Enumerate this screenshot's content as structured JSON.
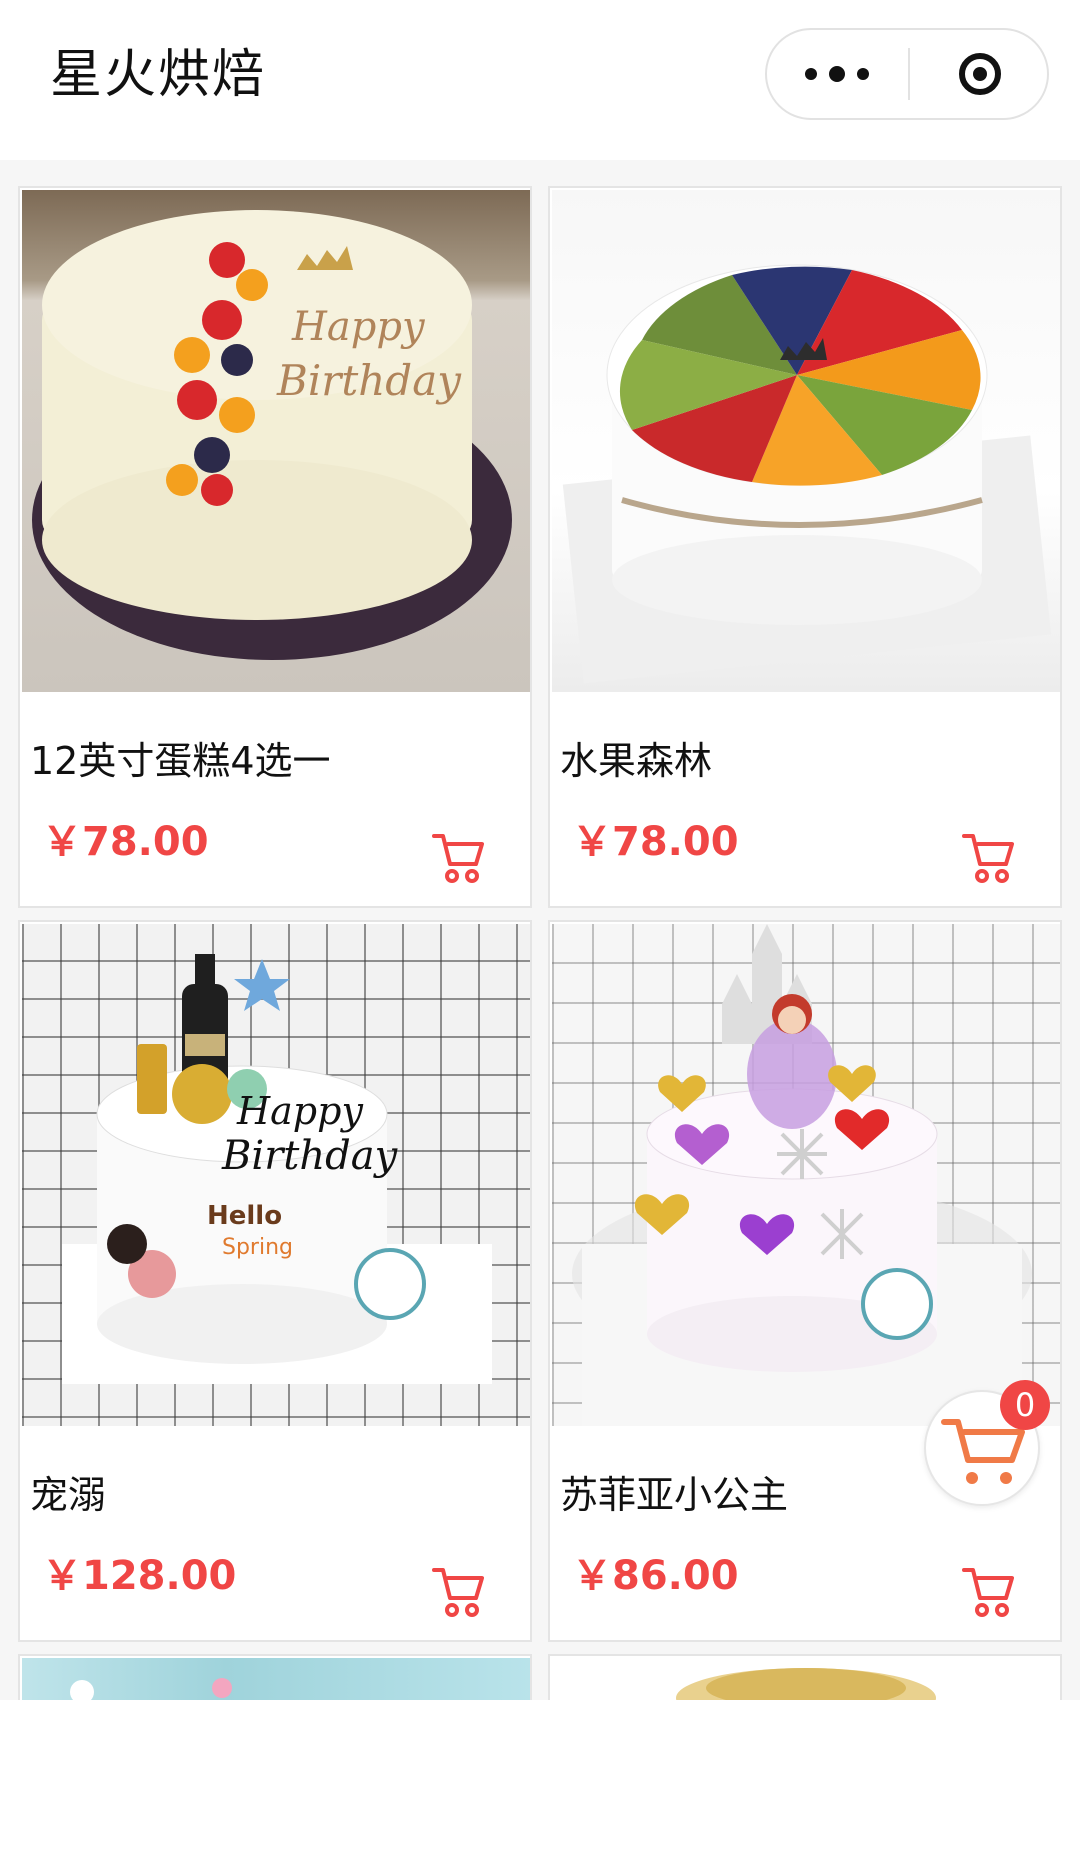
{
  "header": {
    "title": "星火烘焙",
    "more_icon": "more-dots-icon",
    "close_icon": "target-close-icon"
  },
  "products": [
    {
      "name": "12英寸蛋糕4选一",
      "price": "￥78.00",
      "cart_icon": "cart-icon"
    },
    {
      "name": "水果森林",
      "price": "￥78.00",
      "cart_icon": "cart-icon"
    },
    {
      "name": "宠溺",
      "price": "￥128.00",
      "cart_icon": "cart-icon"
    },
    {
      "name": "苏菲亚小公主",
      "price": "￥86.00",
      "cart_icon": "cart-icon"
    }
  ],
  "cart": {
    "count": "0",
    "icon": "cart-icon"
  },
  "colors": {
    "price": "#f04645",
    "badge": "#f04645",
    "cart_stroke": "#f04645",
    "float_cart_stroke": "#f07a47"
  }
}
